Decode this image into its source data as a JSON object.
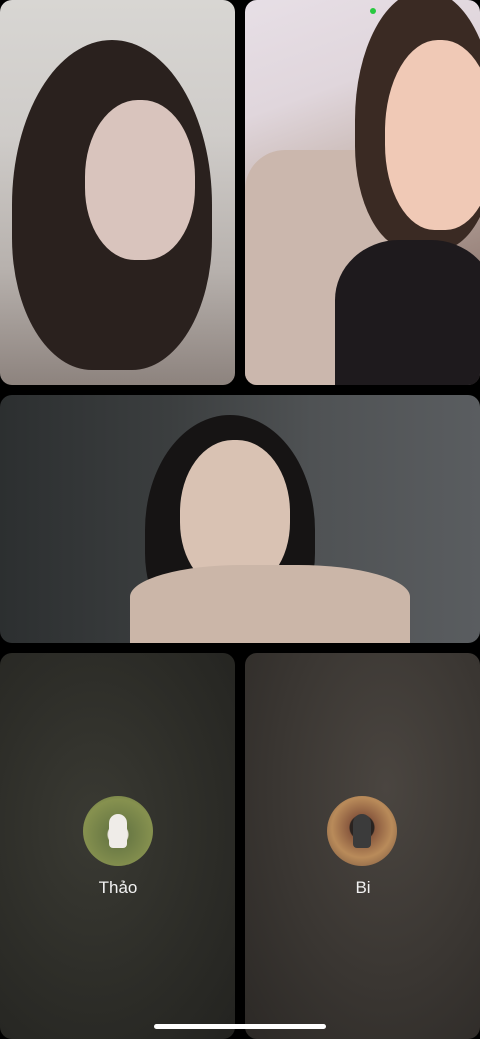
{
  "participants": [
    {
      "id": "p1",
      "state": "video"
    },
    {
      "id": "p2",
      "state": "video"
    },
    {
      "id": "p3",
      "state": "video"
    },
    {
      "id": "p4",
      "state": "avatar",
      "name": "Thảo"
    },
    {
      "id": "p5",
      "state": "avatar",
      "name": "Bi"
    }
  ],
  "indicators": {
    "camera_in_use_color": "#27c93f"
  }
}
